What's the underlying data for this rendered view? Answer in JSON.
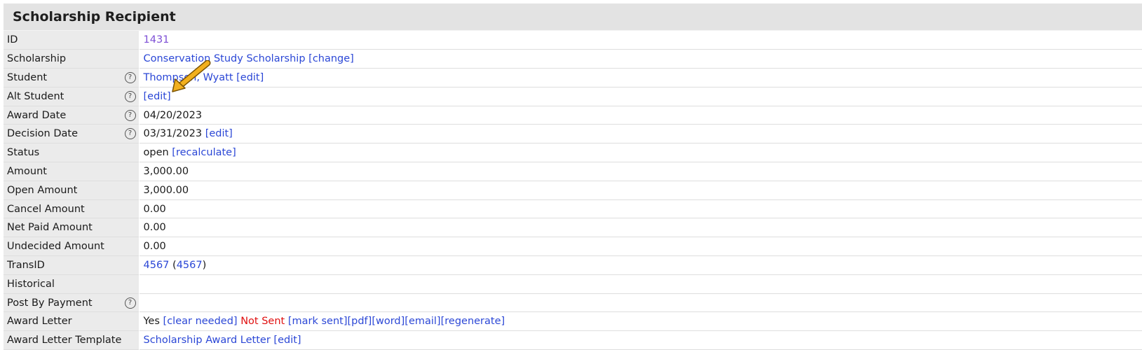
{
  "panel": {
    "title": "Scholarship Recipient"
  },
  "rows": {
    "id": {
      "label": "ID",
      "value_link": "1431"
    },
    "scholarship": {
      "label": "Scholarship",
      "link": "Conservation Study Scholarship",
      "change": "[change]"
    },
    "student": {
      "label": "Student",
      "help": "?",
      "link": "Thompson, Wyatt",
      "edit": "[edit]"
    },
    "alt_student": {
      "label": "Alt Student",
      "help": "?",
      "edit": "[edit]"
    },
    "award_date": {
      "label": "Award Date",
      "help": "?",
      "value": "04/20/2023"
    },
    "decision_date": {
      "label": "Decision Date",
      "help": "?",
      "value": "03/31/2023",
      "edit": "[edit]"
    },
    "status": {
      "label": "Status",
      "value": "open",
      "recalculate": "[recalculate]"
    },
    "amount": {
      "label": "Amount",
      "value": "3,000.00"
    },
    "open_amount": {
      "label": "Open Amount",
      "value": "3,000.00"
    },
    "cancel_amount": {
      "label": "Cancel Amount",
      "value": "0.00"
    },
    "net_paid_amount": {
      "label": "Net Paid Amount",
      "value": "0.00"
    },
    "undecided_amount": {
      "label": "Undecided Amount",
      "value": "0.00"
    },
    "transid": {
      "label": "TransID",
      "link1": "4567",
      "open_paren": "(",
      "link2": "4567",
      "close_paren": ")"
    },
    "historical": {
      "label": "Historical",
      "value": ""
    },
    "post_by_payment": {
      "label": "Post By Payment",
      "help": "?",
      "value": ""
    },
    "award_letter": {
      "label": "Award Letter",
      "value": "Yes",
      "clear_needed": "[clear needed]",
      "not_sent": "Not Sent",
      "mark_sent": "[mark sent]",
      "pdf": "[pdf]",
      "word": "[word]",
      "email": "[email]",
      "regenerate": "[regenerate]"
    },
    "award_letter_template": {
      "label": "Award Letter Template",
      "link": "Scholarship Award Letter",
      "edit": "[edit]"
    }
  },
  "colors": {
    "link": "#2b47d6",
    "visited_link": "#7d4fd6",
    "warning": "#e01010",
    "arrow": "#f2b01e",
    "label_bg": "#ebebeb",
    "header_bg": "#e3e3e3"
  },
  "icons": {
    "help": "question-circle-icon",
    "annotation": "arrow-pointer-icon"
  }
}
